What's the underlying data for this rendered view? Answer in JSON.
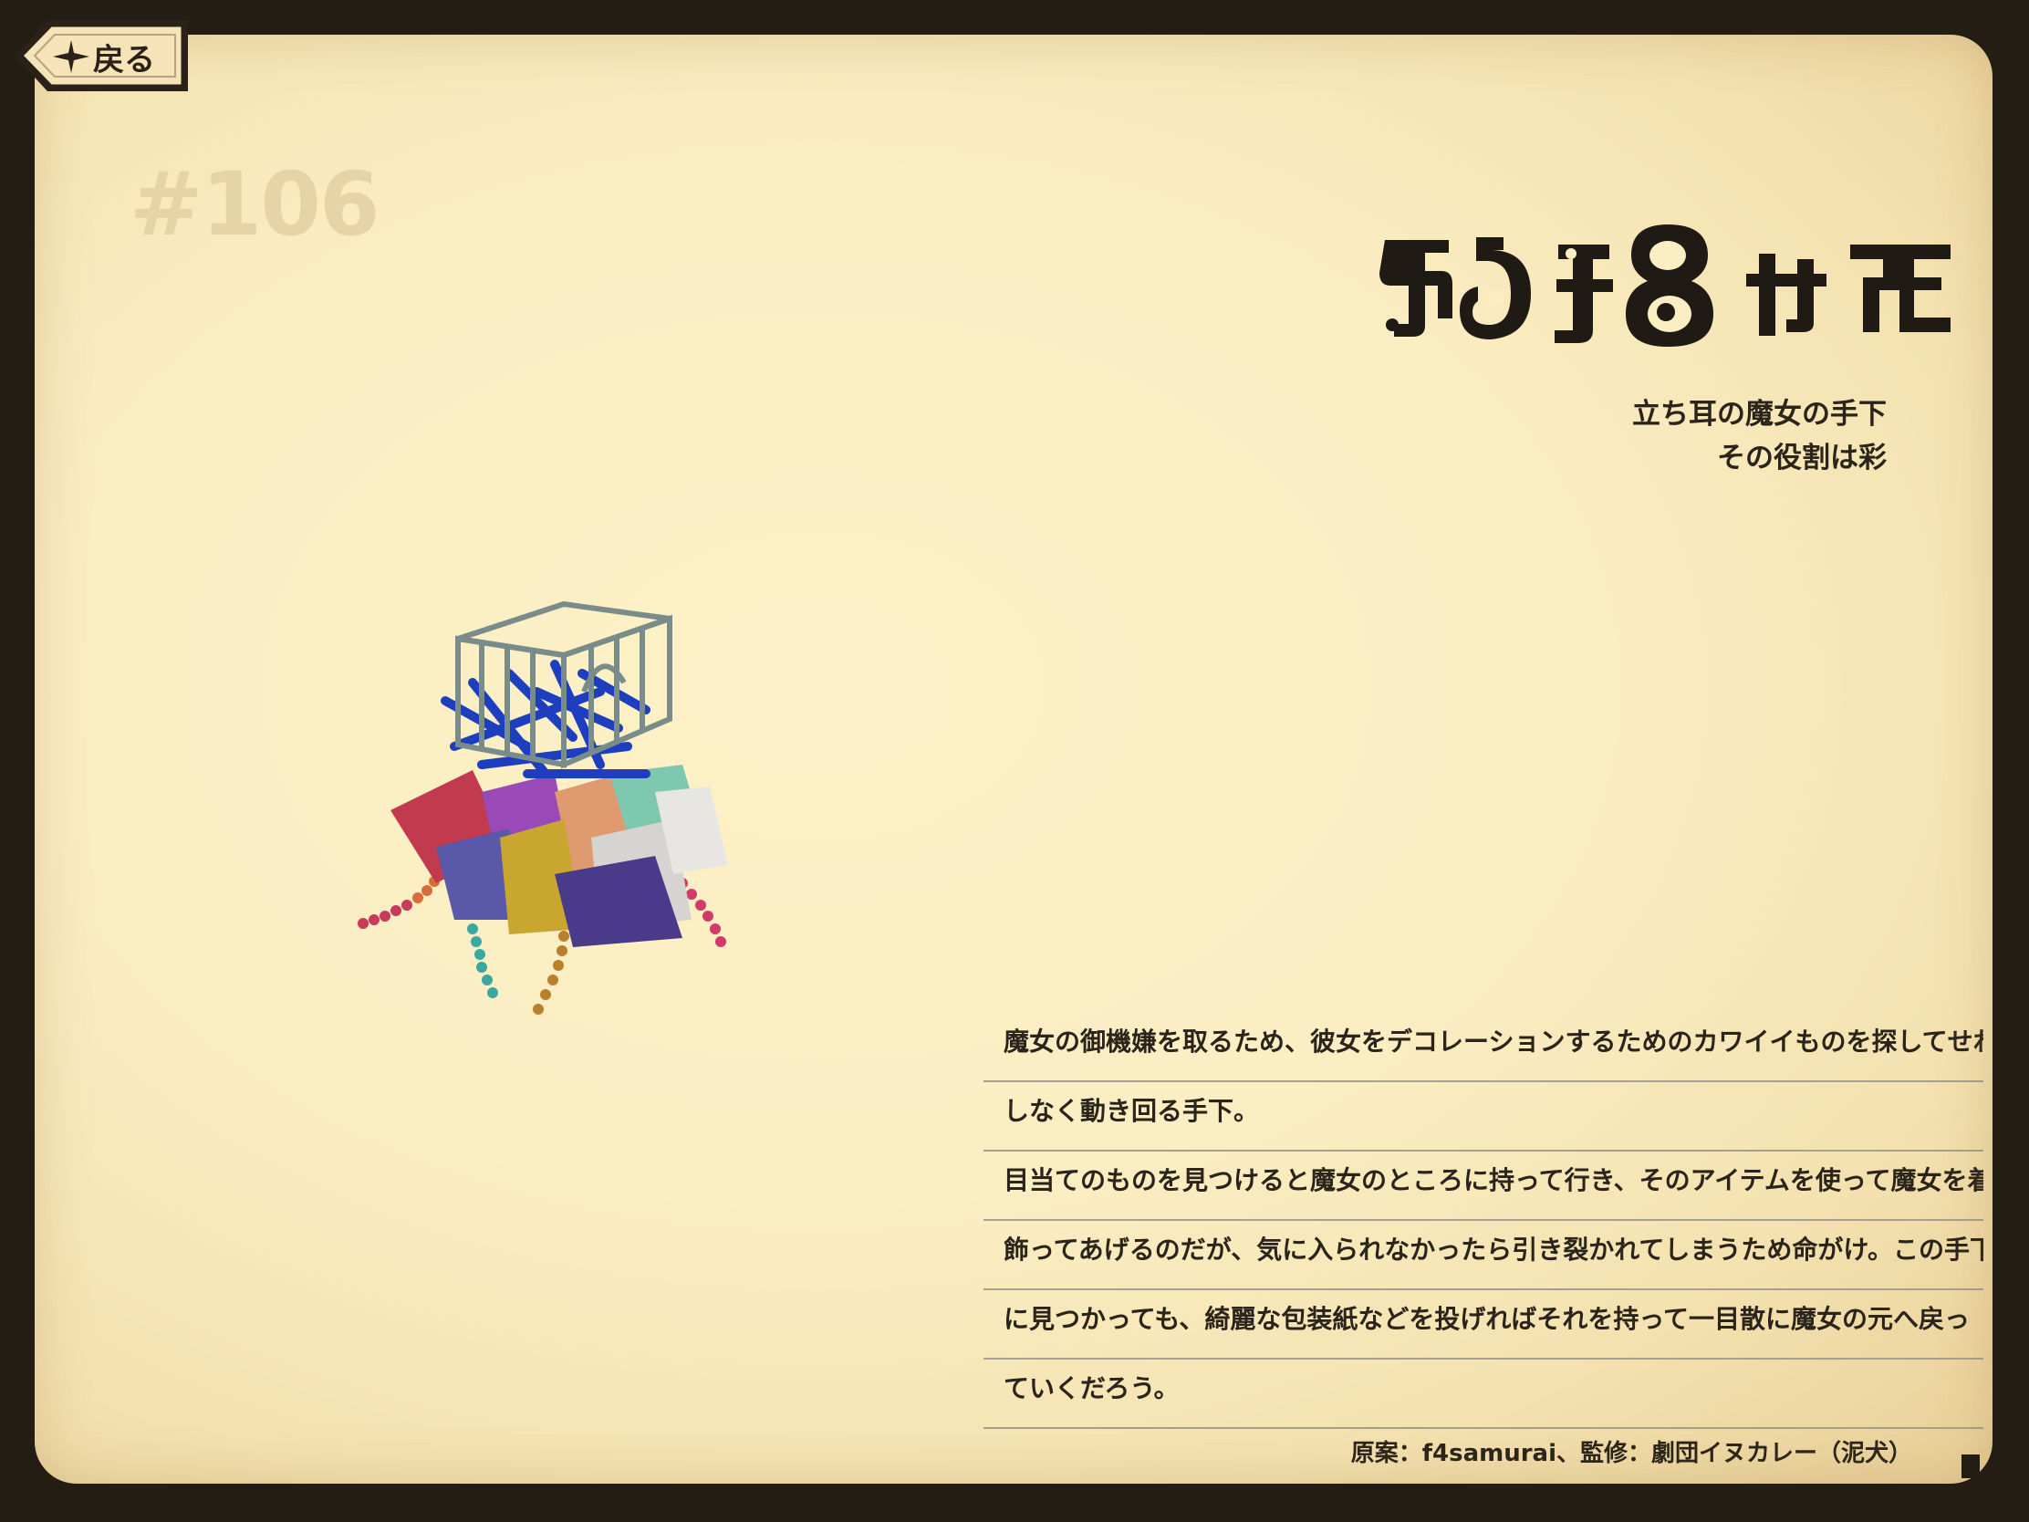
{
  "back_button": {
    "label": "戻る",
    "icon": "sparkle-icon"
  },
  "entry_number": "#106",
  "title_glyphs": "decorative-runic-title",
  "subtitle": {
    "line1": "立ち耳の魔女の手下",
    "line2": "その役割は彩"
  },
  "description_lines": [
    "魔女の御機嫌を取るため、彼女をデコレーションするためのカワイイものを探してせわ",
    "しなく動き回る手下。",
    "目当てのものを見つけると魔女のところに持って行き、そのアイテムを使って魔女を着",
    "飾ってあげるのだが、気に入られなかったら引き裂かれてしまうため命がけ。この手下",
    "に見つかっても、綺麗な包装紙などを投げればそれを持って一目散に魔女の元へ戻っ",
    "ていくだろう。"
  ],
  "credit": "原案：f4samurai、監修：劇団イヌカレー（泥犬）",
  "colors": {
    "paper": "#fbeec3",
    "frame": "#231d14",
    "text": "#2a241a",
    "number": "#e6d4a6"
  }
}
